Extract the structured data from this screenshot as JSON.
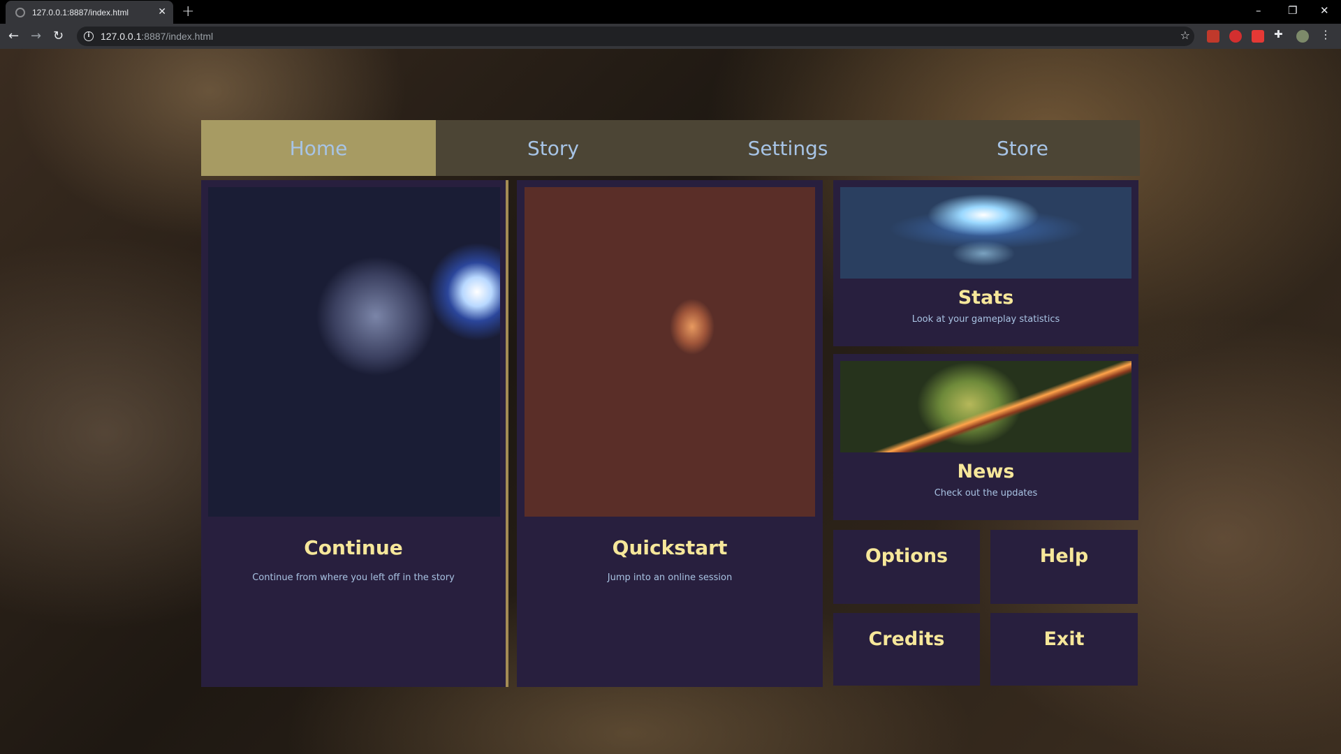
{
  "browser": {
    "tab_title": "127.0.0.1:8887/index.html",
    "tab_close": "✕",
    "new_tab": "+",
    "url_host": "127.0.0.1",
    "url_path": ":8887/index.html",
    "window_controls": [
      "–",
      "❐",
      "✕"
    ]
  },
  "nav": {
    "items": [
      "Home",
      "Story",
      "Settings",
      "Store"
    ],
    "active": "Home"
  },
  "cards": {
    "continue": {
      "title": "Continue",
      "desc": "Continue from where you left off in the story"
    },
    "quickstart": {
      "title": "Quickstart",
      "desc": "Jump into an online session"
    },
    "stats": {
      "title": "Stats",
      "desc": "Look at your gameplay statistics"
    },
    "news": {
      "title": "News",
      "desc": "Check out the updates"
    }
  },
  "buttons": {
    "options": "Options",
    "help": "Help",
    "credits": "Credits",
    "exit": "Exit"
  },
  "colors": {
    "nav_bg": "#4c4535",
    "nav_active": "#a79b63",
    "nav_text": "#a7c4e6",
    "card_bg": "#281f3e",
    "title": "#f6e79a",
    "desc": "#a9c3e3"
  }
}
